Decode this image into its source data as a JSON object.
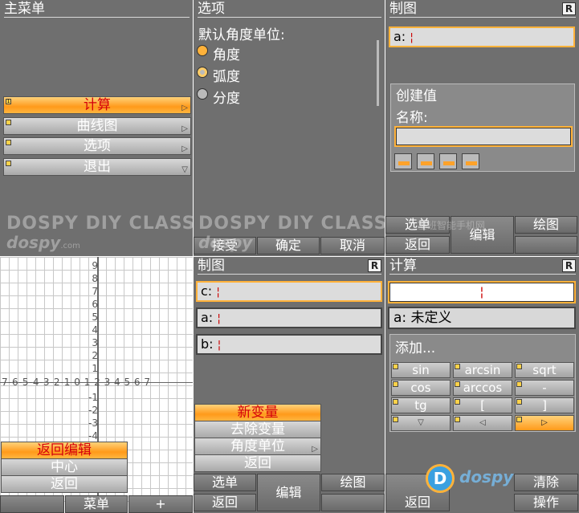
{
  "main_menu": {
    "title": "主菜单",
    "items": [
      {
        "label": "计算",
        "active": true
      },
      {
        "label": "曲线图",
        "active": false
      },
      {
        "label": "选项",
        "active": false
      },
      {
        "label": "退出",
        "active": false
      }
    ]
  },
  "options": {
    "title": "选项",
    "heading": "默认角度单位:",
    "choices": [
      {
        "label": "角度",
        "selected": true
      },
      {
        "label": "弧度",
        "selected": false
      },
      {
        "label": "分度",
        "selected": false
      }
    ],
    "softkeys": {
      "left": "接受",
      "center": "确定",
      "right": "取消"
    }
  },
  "plot_top": {
    "title": "制图",
    "badge": "R",
    "field_a": "a:",
    "create_value": {
      "heading": "创建值",
      "name_label": "名称:",
      "name_value": ""
    },
    "softkeys": {
      "left_top": "选单",
      "left_bottom": "返回",
      "center": "编辑",
      "right": "绘图"
    }
  },
  "graph": {
    "y_labels": [
      "9",
      "8",
      "7",
      "6",
      "5",
      "4",
      "3",
      "2",
      "1",
      "-1",
      "-2",
      "-3",
      "-4"
    ],
    "x_label_row": "7-6-5-4-3-2-1 0 1 2 3 4 5 6 7",
    "menu": [
      {
        "label": "返回编辑",
        "active": true
      },
      {
        "label": "中心",
        "active": false
      },
      {
        "label": "返回",
        "active": false
      }
    ],
    "softkeys": {
      "center": "菜单",
      "right": "+"
    }
  },
  "plot_bottom": {
    "title": "制图",
    "badge": "R",
    "fields": [
      "c:",
      "a:",
      "b:"
    ],
    "menu": [
      {
        "label": "新变量",
        "active": true
      },
      {
        "label": "去除变量",
        "active": false
      },
      {
        "label": "角度单位",
        "active": false
      },
      {
        "label": "返回",
        "active": false
      }
    ],
    "softkeys": {
      "left_top": "选单",
      "left_bottom": "返回",
      "center": "编辑",
      "right": "绘图"
    }
  },
  "calc": {
    "title": "计算",
    "badge": "R",
    "input_value": "",
    "result": "a: 未定义",
    "add_label": "添加...",
    "keys": [
      [
        "sin",
        "arcsin",
        "sqrt"
      ],
      [
        "cos",
        "arccos",
        "-"
      ],
      [
        "tg",
        "[",
        "]"
      ],
      [
        "▽",
        "◁",
        "▷"
      ]
    ],
    "softkeys": {
      "left": "返回",
      "right_top": "清除",
      "right_bottom": "操作"
    }
  },
  "watermark": {
    "logo": "dospy",
    "com": ".com",
    "class_text": "DOSPY DIY CLASS",
    "site": "塞班智能手机网"
  },
  "colors": {
    "panel_bg": "#6f6f6f",
    "accent_orange": "#ff9a1a",
    "active_text": "#d4000b"
  }
}
